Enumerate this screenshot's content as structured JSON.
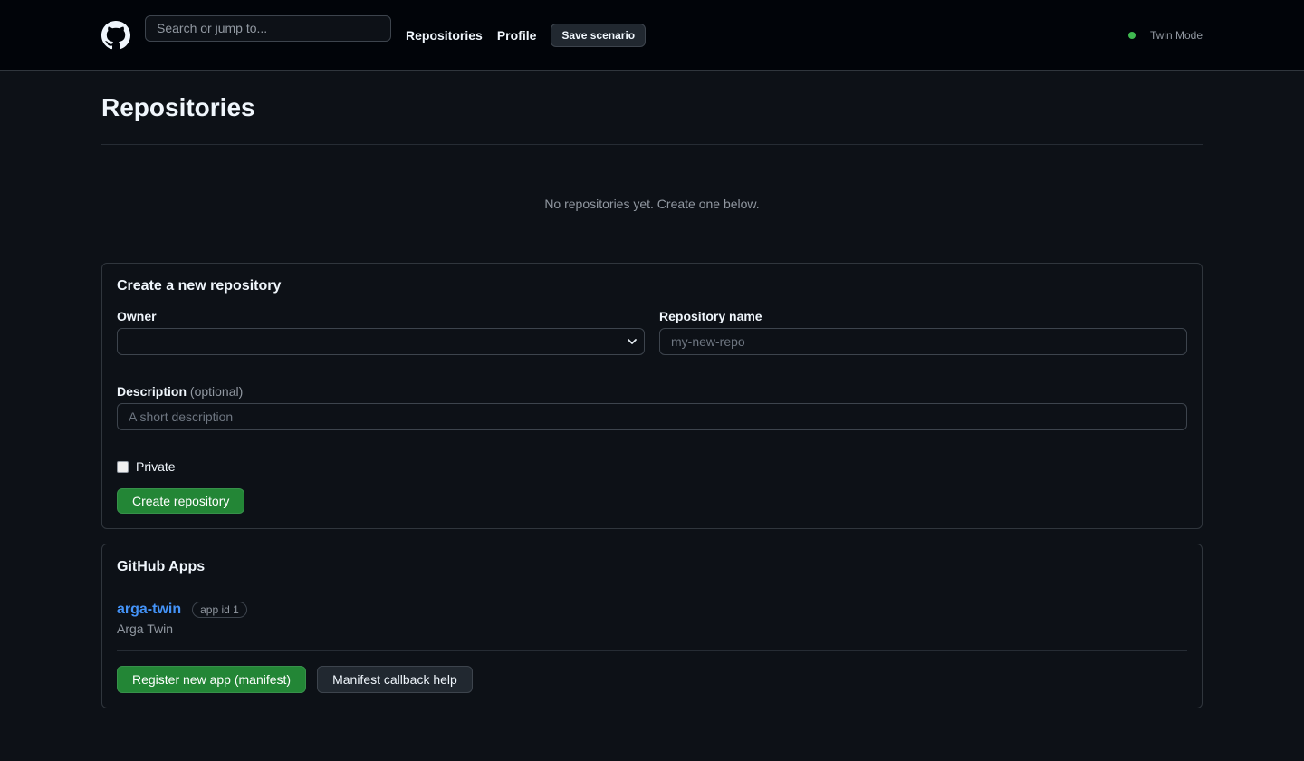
{
  "header": {
    "search_placeholder": "Search or jump to...",
    "nav": [
      "Repositories",
      "Profile"
    ],
    "save_label": "Save scenario",
    "mode_label": "Twin Mode",
    "mode_color": "#3fb950"
  },
  "page": {
    "title": "Repositories",
    "empty_message": "No repositories yet. Create one below."
  },
  "create_form": {
    "title": "Create a new repository",
    "owner_label": "Owner",
    "owner_value": "",
    "name_label": "Repository name",
    "name_placeholder": "my-new-repo",
    "description_label": "Description",
    "description_optional": "(optional)",
    "description_placeholder": "A short description",
    "private_label": "Private",
    "private_checked": false,
    "submit_label": "Create repository"
  },
  "apps": {
    "title": "GitHub Apps",
    "items": [
      {
        "name": "arga-twin",
        "badge": "app id 1",
        "subtitle": "Arga Twin"
      }
    ],
    "register_label": "Register new app (manifest)",
    "help_label": "Manifest callback help"
  }
}
